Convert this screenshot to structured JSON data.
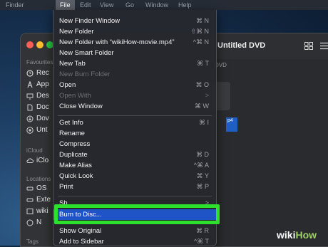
{
  "menubar": [
    "Finder",
    "File",
    "Edit",
    "View",
    "Go",
    "Window",
    "Help"
  ],
  "window": {
    "title": "Untitled DVD",
    "column_label": "DVD",
    "file_label_fragment": "p4"
  },
  "sidebar": {
    "favourites_header": "Favourites",
    "favourites": [
      "Rec",
      "App",
      "Des",
      "Doc",
      "Dov",
      "Unt"
    ],
    "icloud_header": "iCloud",
    "icloud": [
      "iClo"
    ],
    "locations_header": "Locations",
    "locations": [
      "OS",
      "Exte",
      "wiki",
      "N"
    ],
    "tags_header": "Tags"
  },
  "menu": {
    "items": [
      {
        "label": "New Finder Window",
        "shortcut": "⌘ N"
      },
      {
        "label": "New Folder",
        "shortcut": "⇧⌘ N"
      },
      {
        "label": "New Folder with “wikiHow-movie.mp4”",
        "shortcut": "^⌘ N"
      },
      {
        "label": "New Smart Folder",
        "shortcut": ""
      },
      {
        "label": "New Tab",
        "shortcut": "⌘ T"
      },
      {
        "label": "New Burn Folder",
        "shortcut": ""
      },
      {
        "label": "Open",
        "shortcut": "⌘ O"
      },
      {
        "label": "Open With",
        "shortcut": ">"
      },
      {
        "label": "Close Window",
        "shortcut": "⌘ W"
      },
      {
        "label": "Get Info",
        "shortcut": "⌘ I"
      },
      {
        "label": "Rename",
        "shortcut": ""
      },
      {
        "label": "Compress",
        "shortcut": ""
      },
      {
        "label": "Duplicate",
        "shortcut": "⌘ D"
      },
      {
        "label": "Make Alias",
        "shortcut": "^⌘ A"
      },
      {
        "label": "Quick Look",
        "shortcut": "⌘ Y"
      },
      {
        "label": "Print",
        "shortcut": "⌘ P"
      },
      {
        "label": "Sh",
        "shortcut": ">"
      },
      {
        "label": "Burn to Disc...",
        "shortcut": ""
      },
      {
        "label": "Show Original",
        "shortcut": "⌘ R"
      },
      {
        "label": "Add to Sidebar",
        "shortcut": "^⌘ T"
      }
    ]
  },
  "watermark": {
    "part1": "wiki",
    "part2": "How"
  }
}
